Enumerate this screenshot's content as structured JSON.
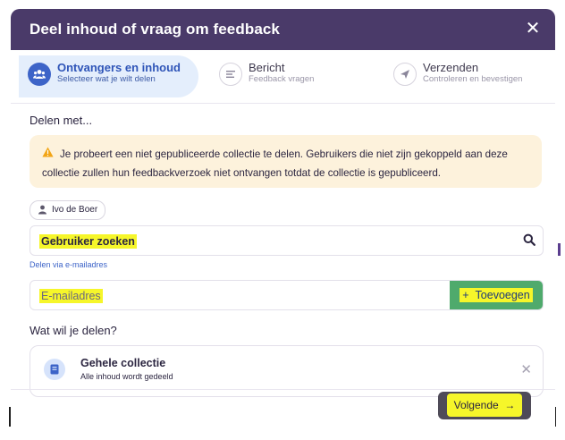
{
  "dialog": {
    "title": "Deel inhoud of vraag om feedback",
    "close_glyph": "✕"
  },
  "stepper": {
    "steps": [
      {
        "title": "Ontvangers en inhoud",
        "subtitle": "Selecteer wat je wilt delen",
        "icon": "users-icon",
        "state": "active"
      },
      {
        "title": "Bericht",
        "subtitle": "Feedback vragen",
        "icon": "message-icon",
        "state": "inactive"
      },
      {
        "title": "Verzenden",
        "subtitle": "Controleren en bevestigen",
        "icon": "send-icon",
        "state": "inactive"
      }
    ]
  },
  "share_with": {
    "label": "Delen met...",
    "warning": "Je probeert een niet gepubliceerde collectie te delen. Gebruikers die niet zijn gekoppeld aan deze collectie zullen hun feedbackverzoek niet ontvangen totdat de collectie is gepubliceerd.",
    "recipient_chip": "Ivo de Boer",
    "search_placeholder": "Gebruiker zoeken",
    "email_link": "Delen via e-mailadres",
    "email_placeholder": "E-mailadres",
    "add_button": "Toevoegen"
  },
  "what_to_share": {
    "label": "Wat wil je delen?",
    "option_title": "Gehele collectie",
    "option_subtitle": "Alle inhoud wordt gedeeld"
  },
  "footer": {
    "next_button": "Volgende"
  },
  "colors": {
    "header": "#4a3a69",
    "accent": "#3d64c8",
    "warning_bg": "#fdf2dc",
    "add_button_bg": "#4faa6c",
    "highlight": "#f6f62a"
  }
}
